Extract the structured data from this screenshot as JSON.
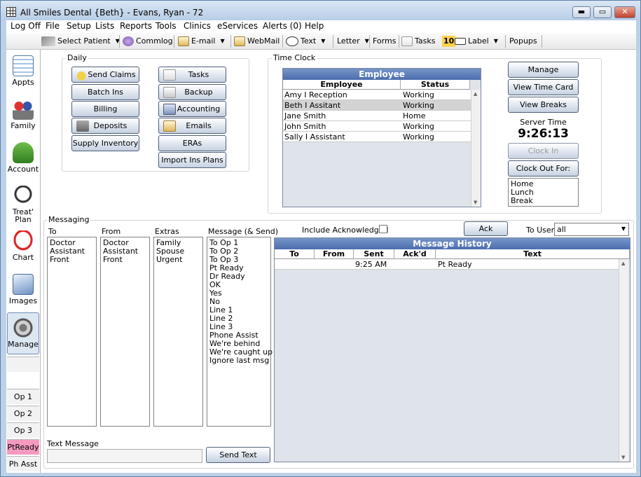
{
  "window": {
    "title": "All Smiles Dental {Beth} - Evans, Ryan - 72",
    "minimize": "▬",
    "maximize": "▭",
    "close": "✕"
  },
  "menu": [
    "Log Off",
    "File",
    "Setup",
    "Lists",
    "Reports",
    "Tools",
    "Clinics",
    "eServices",
    "Alerts (0)",
    "Help"
  ],
  "toolbar": {
    "select_patient": "Select Patient",
    "commlog": "Commlog",
    "email": "E-mail",
    "webmail": "WebMail",
    "text": "Text",
    "letter": "Letter",
    "forms": "Forms",
    "tasks": "Tasks",
    "tasks_count": "10",
    "label": "Label",
    "popups": "Popups"
  },
  "sidebar": {
    "modules": [
      "Appts",
      "Family",
      "Account",
      "Treat' Plan",
      "Chart",
      "Images",
      "Manage"
    ],
    "ops": [
      "Op 1",
      "Op 2",
      "Op 3",
      "PtReady",
      "Ph Asst"
    ],
    "ptready_color": "#f49ac1"
  },
  "daily": {
    "label": "Daily",
    "left_buttons": [
      "Send Claims",
      "Batch Ins",
      "Billing",
      "Deposits",
      "Supply Inventory"
    ],
    "right_buttons": [
      "Tasks",
      "Backup",
      "Accounting",
      "Emails",
      "ERAs",
      "Import Ins Plans"
    ]
  },
  "timeclock": {
    "label": "Time Clock",
    "grid_title": "Employee",
    "columns": [
      "Employee",
      "Status"
    ],
    "rows": [
      {
        "employee": "Amy I Reception",
        "status": "Working"
      },
      {
        "employee": "Beth I Assitant",
        "status": "Working"
      },
      {
        "employee": "Jane  Smith",
        "status": "Home"
      },
      {
        "employee": "John  Smith",
        "status": "Working"
      },
      {
        "employee": "Sally I Assistant",
        "status": "Working"
      }
    ],
    "manage": "Manage",
    "view_time_card": "View Time Card",
    "view_breaks": "View Breaks",
    "server_time_label": "Server Time",
    "server_time": "9:26:13",
    "clock_in": "Clock In",
    "clock_out_for": "Clock Out For:",
    "clock_out_options": [
      "Home",
      "Lunch",
      "Break"
    ]
  },
  "messaging": {
    "label": "Messaging",
    "to_label": "To",
    "to_items": [
      "Doctor",
      "Assistant",
      "Front"
    ],
    "from_label": "From",
    "from_items": [
      "Doctor",
      "Assistant",
      "Front"
    ],
    "extras_label": "Extras",
    "extras_items": [
      "Family",
      "Spouse",
      "Urgent"
    ],
    "message_label": "Message (& Send)",
    "message_items": [
      "To Op 1",
      "To Op 2",
      "To Op 3",
      "Pt Ready",
      "Dr Ready",
      "OK",
      "Yes",
      "No",
      "Line 1",
      "Line 2",
      "Line 3",
      "Phone Assist",
      "We're behind",
      "We're caught up",
      "Ignore last msg"
    ],
    "include_acknowledged": "Include Acknowledged",
    "ack": "Ack",
    "to_user_label": "To User",
    "to_user_value": "all",
    "text_message_label": "Text Message",
    "text_message_value": "",
    "send_text": "Send Text",
    "history_title": "Message History",
    "history_columns": [
      "To",
      "From",
      "Sent",
      "Ack'd",
      "Text"
    ],
    "history_rows": [
      {
        "to": "",
        "from": "",
        "sent": "9:25 AM",
        "ackd": "",
        "text": "Pt Ready"
      }
    ]
  }
}
